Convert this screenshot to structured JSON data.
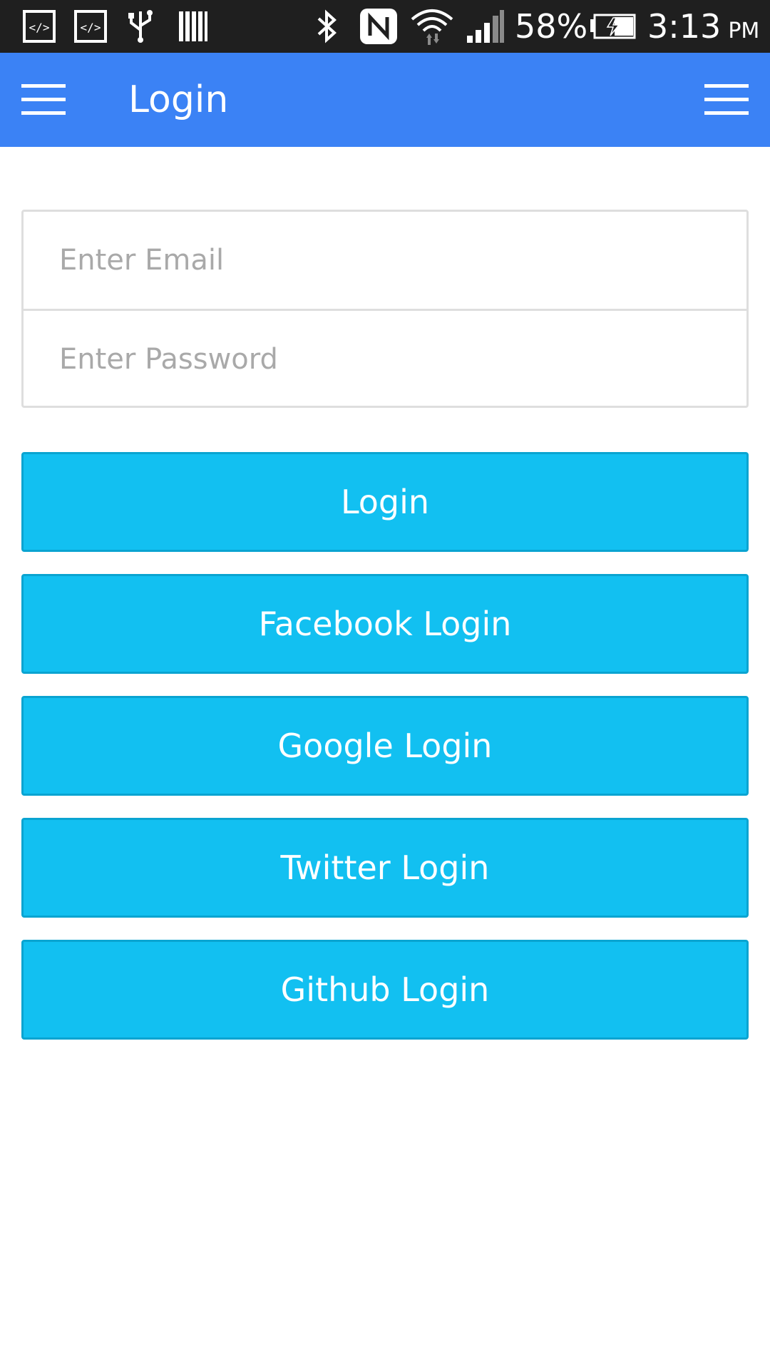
{
  "status_bar": {
    "battery_percent": "58%",
    "time": "3:13",
    "time_suffix": "PM",
    "icons": [
      "code-icon",
      "code-icon",
      "usb-icon",
      "barcode-icon",
      "bluetooth-icon",
      "nfc-icon",
      "wifi-icon",
      "signal-icon",
      "battery-charging-icon"
    ]
  },
  "app_bar": {
    "title": "Login",
    "left_icon": "menu-icon",
    "right_icon": "menu-icon",
    "color": "#3b82f5"
  },
  "form": {
    "email_placeholder": "Enter Email",
    "email_value": "",
    "password_placeholder": "Enter Password",
    "password_value": ""
  },
  "buttons": {
    "login": "Login",
    "facebook": "Facebook Login",
    "google": "Google Login",
    "twitter": "Twitter Login",
    "github": "Github Login",
    "color": "#12c0f1"
  }
}
